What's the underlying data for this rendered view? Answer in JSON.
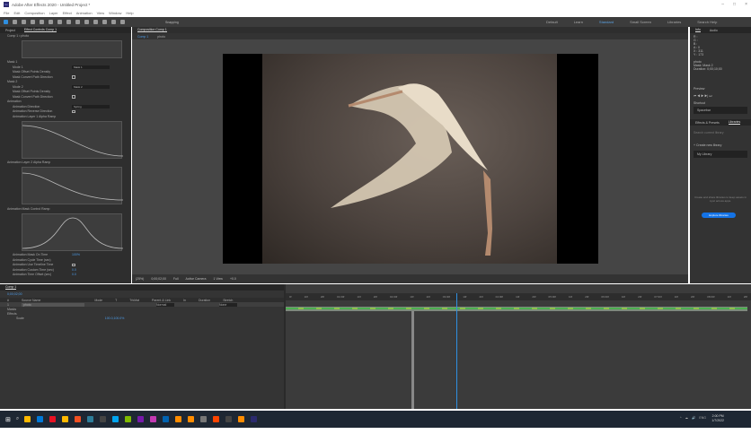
{
  "window": {
    "title": "Adobe After Effects 2020 - Untitled Project *",
    "controls": [
      "–",
      "□",
      "×"
    ]
  },
  "menu": [
    "File",
    "Edit",
    "Composition",
    "Layer",
    "Effect",
    "Animation",
    "View",
    "Window",
    "Help"
  ],
  "toolbar": {
    "snapping": "Snapping",
    "workspaces": [
      "Default",
      "Learn",
      "Standard",
      "Small Screen",
      "Libraries"
    ],
    "active_workspace": "Standard",
    "search": "Search Help"
  },
  "left_panel": {
    "tabs": [
      "Project",
      "Effect Controls Comp 1"
    ],
    "subtitle": "Comp 1 • photo",
    "rows": [
      {
        "label": "Mask 1",
        "type": "group"
      },
      {
        "label": "Mode 1",
        "value": "Mask 1"
      },
      {
        "label": "Mask Offset Points Density"
      },
      {
        "label": "Mask Convert Path Direction",
        "check": true
      },
      {
        "label": "Mask 2",
        "type": "group"
      },
      {
        "label": "Mode 2",
        "value": "Mask 2"
      },
      {
        "label": "Mask Offset Points Density"
      },
      {
        "label": "Mask Convert Path Direction",
        "check": true
      },
      {
        "label": "Animation",
        "type": "group"
      },
      {
        "label": "Animation Direction",
        "value": "Spring"
      },
      {
        "label": "Animation Reverse Direction",
        "check": true
      },
      {
        "label": "Animation Layer 1 Alpha Ramp"
      }
    ],
    "graph_labels": [
      "Animation Layer 2 Alpha Ramp",
      "Animation Mask Control Ramp"
    ],
    "bottom_rows": [
      {
        "label": "Animation Mask On Time",
        "num": "100%"
      },
      {
        "label": "Animation Cycle Time (sec)",
        "num": ""
      },
      {
        "label": "Animation Use Timeline Time",
        "check": true
      },
      {
        "label": "Animation Custom Time (sec)",
        "num": "0.0"
      },
      {
        "label": "Animation Time Offset (sec)",
        "num": "0.0"
      }
    ]
  },
  "comp": {
    "tab": "Composition Comp 1",
    "breadcrumb": [
      "Comp 1",
      "photo"
    ],
    "footer": {
      "zoom": "(25%)",
      "timecode": "0;00;02;00",
      "resolution": "Full",
      "camera": "Active Camera",
      "views": "1 View",
      "offset": "+0.0"
    }
  },
  "right_panel": {
    "tabs": [
      "Info",
      "Audio"
    ],
    "info": [
      "R :",
      "G :",
      "B :",
      "A : 0",
      "X : 311",
      "Y : 173"
    ],
    "layer_info": [
      "photo",
      "Mask: Mask 2",
      "Duration: 0;00;10;00"
    ],
    "preview": "Preview",
    "shortcut_label": "Shortcut",
    "shortcut": "Spacebar",
    "fps": [
      "Frame Rate",
      "Skip",
      "Resolution"
    ],
    "tabs2": [
      "Effects & Presets",
      "Libraries"
    ],
    "search": "Search current library",
    "create_library": "+ Create new library",
    "my_library": "My Library",
    "empty_text": "Create and share libraries to keep assets in sync across apps.",
    "explore": "Explore libraries"
  },
  "timeline": {
    "tab": "Comp 1",
    "timecode": "0;00;02;00",
    "columns": [
      "#",
      "Source Name",
      "Mode",
      "T",
      "TrkMat",
      "Parent & Link",
      "In",
      "Duration",
      "Stretch"
    ],
    "layer": {
      "num": "1",
      "name": "photo",
      "mode": "Normal",
      "parent": "None"
    },
    "subrows": [
      "Masks",
      "Effects",
      "Scale"
    ],
    "scale_value": "100.0,100.0%",
    "ruler": [
      "0f",
      "10f",
      "20f",
      "01:00f",
      "10f",
      "20f",
      "02:00f",
      "10f",
      "20f",
      "03:00f",
      "10f",
      "20f",
      "04:00f",
      "10f",
      "20f",
      "05:00f",
      "10f",
      "20f",
      "06:00f",
      "10f",
      "20f",
      "07:00f",
      "10f",
      "20f",
      "08:00f",
      "10f",
      "20f"
    ]
  },
  "taskbar": {
    "time": "2:00 PM",
    "date": "1/7/2022",
    "lang": "ENG",
    "apps": [
      "#ffb900",
      "#0078d7",
      "#e81123",
      "#ffb900",
      "#f25022",
      "#2d7d9a",
      "#444",
      "#00a4ef",
      "#7fba00",
      "#7719aa",
      "#c239b3",
      "#0063b1",
      "#ff8c00",
      "#ff8c00",
      "#777",
      "#ff4500",
      "#444",
      "#ff8c00",
      "#2b2a6e"
    ]
  },
  "colors": {
    "accent": "#2f8fe0",
    "panel": "#2e2e2e",
    "taskbar": "#1e2733"
  }
}
